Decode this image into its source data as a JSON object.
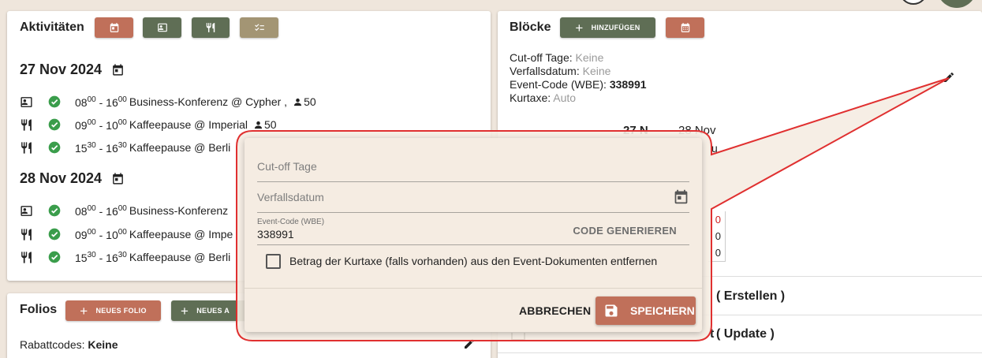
{
  "activities": {
    "title": "Aktivitäten",
    "dates": [
      {
        "date": "27 Nov 2024",
        "events": [
          {
            "icon": "person-card-icon",
            "time_start_h": "08",
            "time_start_m": "00",
            "time_end_h": "16",
            "time_end_m": "00",
            "desc": "Business-Konferenz @ Cypher ,",
            "pax": "50"
          },
          {
            "icon": "cutlery-icon",
            "time_start_h": "09",
            "time_start_m": "00",
            "time_end_h": "10",
            "time_end_m": "00",
            "desc": "Kaffeepause @ Imperial",
            "pax": "50"
          },
          {
            "icon": "cutlery-icon",
            "time_start_h": "15",
            "time_start_m": "30",
            "time_end_h": "16",
            "time_end_m": "30",
            "desc": "Kaffeepause @ Berli"
          }
        ]
      },
      {
        "date": "28 Nov 2024",
        "events": [
          {
            "icon": "person-card-icon",
            "time_start_h": "08",
            "time_start_m": "00",
            "time_end_h": "16",
            "time_end_m": "00",
            "desc": "Business-Konferenz"
          },
          {
            "icon": "cutlery-icon",
            "time_start_h": "09",
            "time_start_m": "00",
            "time_end_h": "10",
            "time_end_m": "00",
            "desc": "Kaffeepause @ Impe"
          },
          {
            "icon": "cutlery-icon",
            "time_start_h": "15",
            "time_start_m": "30",
            "time_end_h": "16",
            "time_end_m": "30",
            "desc": "Kaffeepause @ Berli"
          }
        ]
      }
    ]
  },
  "folios": {
    "title": "Folios",
    "new_folio_label": "NEUES FOLIO",
    "new_second_label": "NEUES A",
    "discount_label": "Rabattcodes:",
    "discount_value": "Keine"
  },
  "blocks": {
    "title": "Blöcke",
    "add_label": "HINZUFÜGEN",
    "cutoff_label": "Cut-off Tage:",
    "cutoff_value": "Keine",
    "expiry_label": "Verfallsdatum:",
    "expiry_value": "Keine",
    "eventcode_label": "Event-Code (WBE):",
    "eventcode_value": "338991",
    "tax_label": "Kurtaxe:",
    "tax_value": "Auto",
    "partial_date_a": "27 N",
    "partial_date_b": "28 Nov",
    "partial_text_c": "u",
    "partial_zero": "0",
    "create_label": "( Erstellen )",
    "update_prefix": "t",
    "update_label": "( Update )"
  },
  "dialog": {
    "cutoff_placeholder": "Cut-off Tage",
    "expiry_placeholder": "Verfallsdatum",
    "eventcode_label": "Event-Code (WBE)",
    "eventcode_value": "338991",
    "generate_label": "CODE GENERIEREN",
    "checkbox_label": "Betrag der Kurtaxe (falls vorhanden) aus den Event-Dokumenten entfernen",
    "cancel_label": "ABBRECHEN",
    "save_label": "SPEICHERN"
  },
  "colors": {
    "primary_red": "#c0705a",
    "primary_green": "#5f6e55",
    "tan": "#a39574",
    "check_green": "#3a9d4b",
    "callout_red": "#e03030"
  }
}
